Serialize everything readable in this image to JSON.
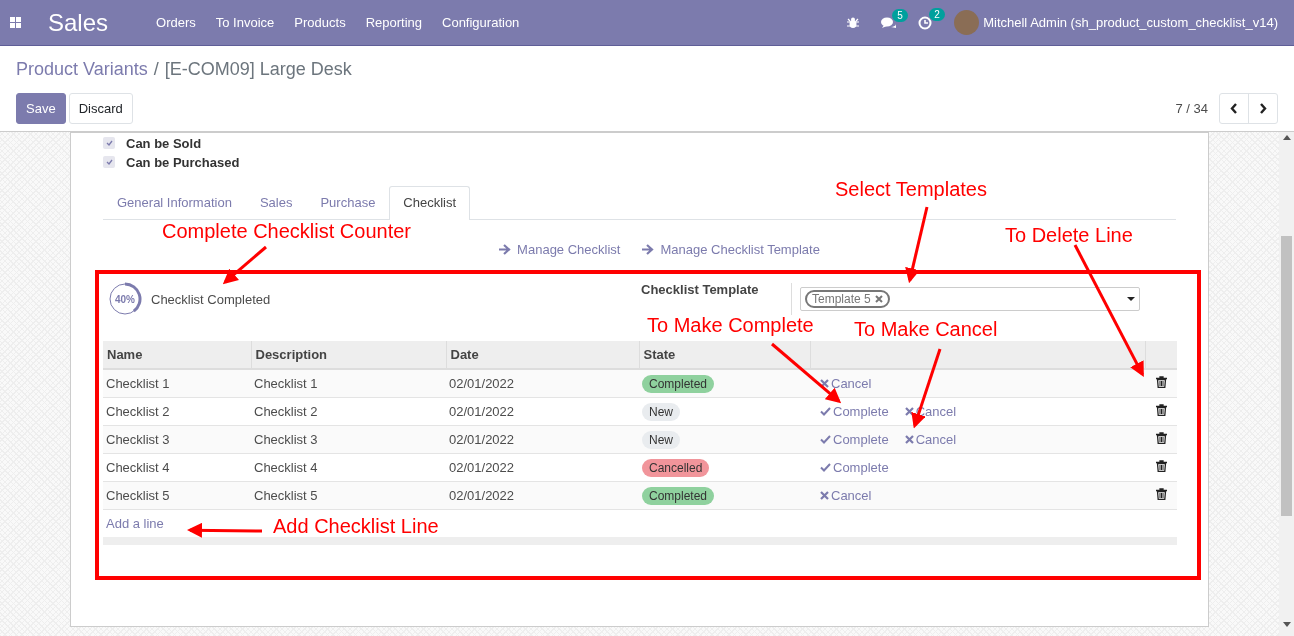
{
  "navbar": {
    "app_title": "Sales",
    "menu": [
      "Orders",
      "To Invoice",
      "Products",
      "Reporting",
      "Configuration"
    ],
    "messages_count": "5",
    "activities_count": "2",
    "user": "Mitchell Admin (sh_product_custom_checklist_v14)"
  },
  "breadcrumb": {
    "parent": "Product Variants",
    "separator": "/",
    "current": "[E-COM09] Large Desk"
  },
  "buttons": [
    {
      "label": "Save",
      "kind": "primary"
    },
    {
      "label": "Discard",
      "kind": "secondary"
    }
  ],
  "pager": "7 / 34",
  "checkboxes": [
    {
      "label": "Can be Sold",
      "checked": true
    },
    {
      "label": "Can be Purchased",
      "checked": true
    }
  ],
  "tabs": [
    {
      "label": "General Information",
      "selected": false
    },
    {
      "label": "Sales",
      "selected": false
    },
    {
      "label": "Purchase",
      "selected": false
    },
    {
      "label": "Checklist",
      "selected": true
    }
  ],
  "action_links": [
    "Manage Checklist",
    "Manage Checklist Template"
  ],
  "progress": {
    "reading": "40%",
    "level": 0.4,
    "label": "Checklist Completed"
  },
  "template_field": {
    "label": "Checklist Template",
    "tags": [
      "Template 5"
    ]
  },
  "table": {
    "columns": [
      "Name",
      "Description",
      "Date",
      "State"
    ],
    "rows": [
      {
        "name": "Checklist 1",
        "description": "Checklist 1",
        "date": "02/01/2022",
        "state": "Completed",
        "color": "#8fd19e",
        "actions": [
          {
            "kind": "cancel",
            "label": "Cancel"
          }
        ]
      },
      {
        "name": "Checklist 2",
        "description": "Checklist 2",
        "date": "02/01/2022",
        "state": "New",
        "color": "#e9ecef",
        "actions": [
          {
            "kind": "complete",
            "label": "Complete"
          },
          {
            "kind": "cancel",
            "label": "Cancel"
          }
        ]
      },
      {
        "name": "Checklist 3",
        "description": "Checklist 3",
        "date": "02/01/2022",
        "state": "New",
        "color": "#e9ecef",
        "actions": [
          {
            "kind": "complete",
            "label": "Complete"
          },
          {
            "kind": "cancel",
            "label": "Cancel"
          }
        ]
      },
      {
        "name": "Checklist 4",
        "description": "Checklist 4",
        "date": "02/01/2022",
        "state": "Cancelled",
        "color": "#f1959b",
        "actions": [
          {
            "kind": "complete",
            "label": "Complete"
          }
        ]
      },
      {
        "name": "Checklist 5",
        "description": "Checklist 5",
        "date": "02/01/2022",
        "state": "Completed",
        "color": "#8fd19e",
        "actions": [
          {
            "kind": "cancel",
            "label": "Cancel"
          }
        ]
      }
    ],
    "add_line": "Add a line"
  },
  "annotations": [
    "Complete Checklist Counter",
    "Select Templates",
    "To Delete Line",
    "To Make Complete",
    "To Make Cancel",
    "Add Checklist Line"
  ]
}
